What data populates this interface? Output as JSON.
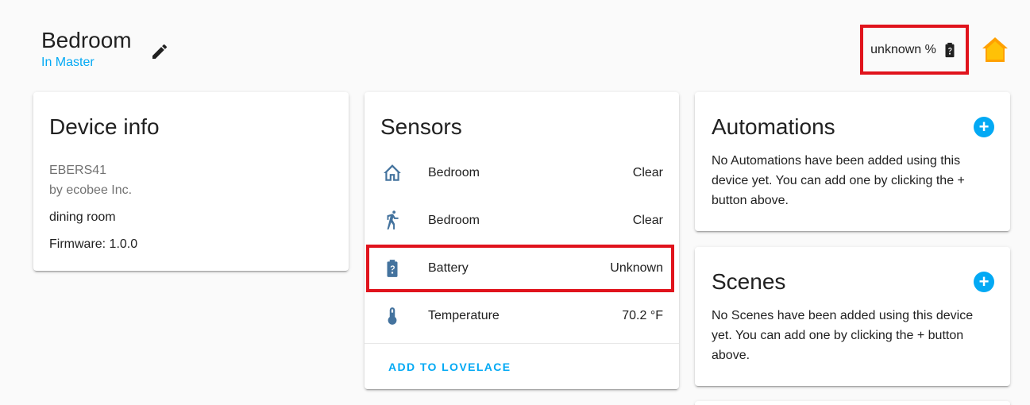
{
  "header": {
    "title": "Bedroom",
    "area": "In Master",
    "battery_text": "unknown %"
  },
  "device_info": {
    "title": "Device info",
    "model": "EBERS41",
    "manufacturer": "by ecobee Inc.",
    "area": "dining room",
    "firmware": "Firmware: 1.0.0"
  },
  "sensors": {
    "title": "Sensors",
    "rows": [
      {
        "icon": "home-outline-icon",
        "name": "Bedroom",
        "state": "Clear"
      },
      {
        "icon": "walk-icon",
        "name": "Bedroom",
        "state": "Clear"
      },
      {
        "icon": "battery-unknown-icon",
        "name": "Battery",
        "state": "Unknown"
      },
      {
        "icon": "thermometer-icon",
        "name": "Temperature",
        "state": "70.2 °F"
      }
    ],
    "action": "ADD TO LOVELACE"
  },
  "automations": {
    "title": "Automations",
    "text": "No Automations have been added using this device yet. You can add one by clicking the + button above."
  },
  "scenes": {
    "title": "Scenes",
    "text": "No Scenes have been added using this device yet. You can add one by clicking the + button above."
  },
  "colors": {
    "accent": "#03a9f4",
    "highlight": "#e0131c",
    "sensor_icon": "#44739e",
    "home_icon": "#ffa000"
  }
}
